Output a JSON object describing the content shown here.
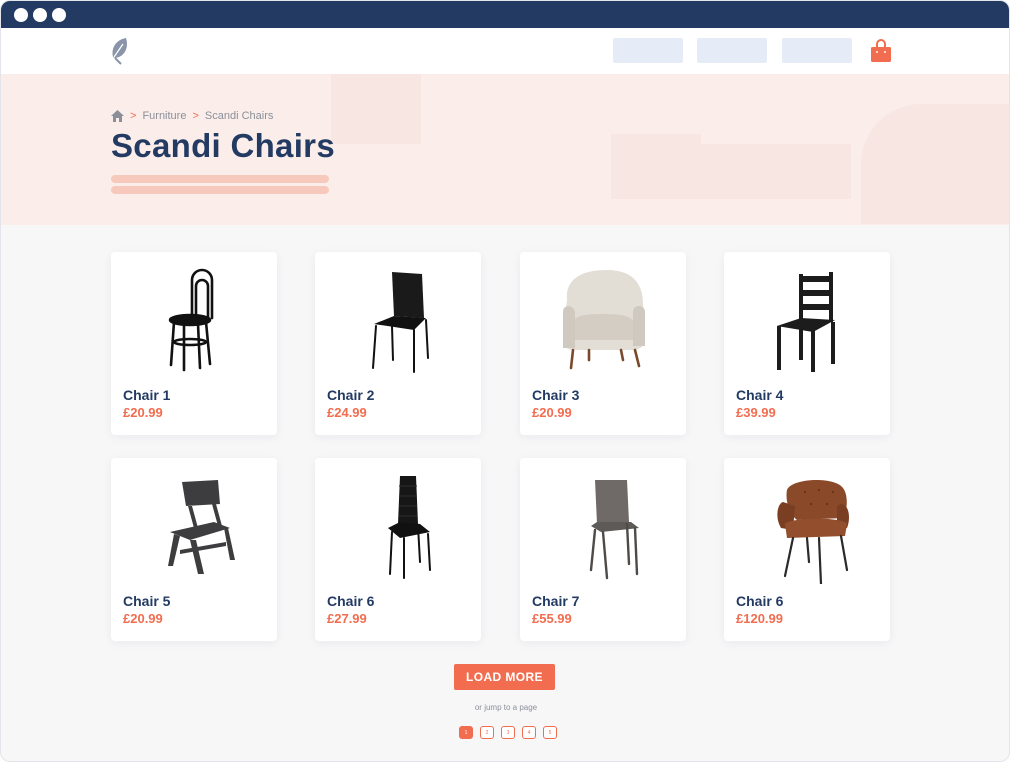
{
  "header": {
    "logo_icon": "leaf-icon",
    "cart_icon": "shopping-bag-icon",
    "accent_color": "#f26d4f",
    "brand_color": "#233b63"
  },
  "breadcrumb": {
    "home_icon": "home-icon",
    "items": [
      "Furniture",
      "Scandi Chairs"
    ]
  },
  "page": {
    "title": "Scandi Chairs"
  },
  "products": [
    {
      "name": "Chair 1",
      "price": "£20.99"
    },
    {
      "name": "Chair 2",
      "price": "£24.99"
    },
    {
      "name": "Chair 3",
      "price": "£20.99"
    },
    {
      "name": "Chair 4",
      "price": "£39.99"
    },
    {
      "name": "Chair 5",
      "price": "£20.99"
    },
    {
      "name": "Chair 6",
      "price": "£27.99"
    },
    {
      "name": "Chair 7",
      "price": "£55.99"
    },
    {
      "name": "Chair 6",
      "price": "£120.99"
    }
  ],
  "pagination": {
    "load_more_label": "LOAD MORE",
    "jump_text": "or jump to a page",
    "pages": [
      "1",
      "2",
      "3",
      "4",
      "5"
    ],
    "current_page": "1"
  }
}
